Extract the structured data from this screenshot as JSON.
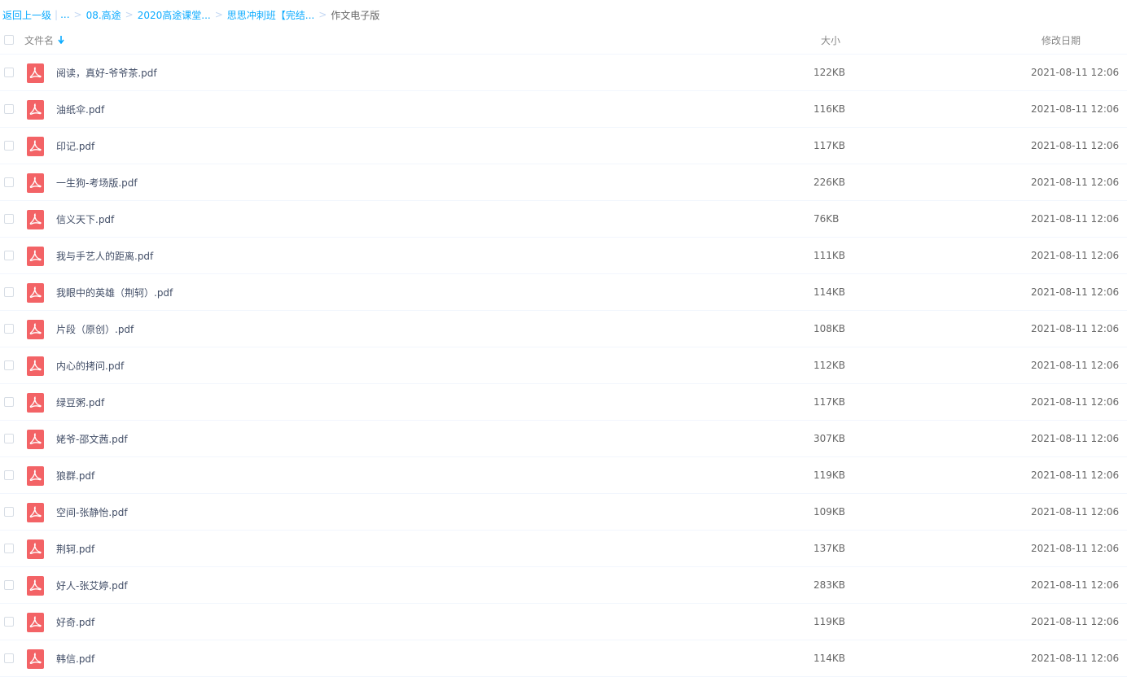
{
  "breadcrumb": {
    "back": "返回上一级",
    "separator": ">",
    "items": [
      "...",
      "08.高途",
      "2020高途课堂...",
      "思思冲刺班【完结...",
      "作文电子版"
    ]
  },
  "columns": {
    "name": "文件名",
    "size": "大小",
    "date": "修改日期",
    "sort_icon": "arrow-down-icon"
  },
  "files": [
    {
      "name": "阅读，真好-爷爷茶.pdf",
      "size": "122KB",
      "date": "2021-08-11 12:06"
    },
    {
      "name": "油纸伞.pdf",
      "size": "116KB",
      "date": "2021-08-11 12:06"
    },
    {
      "name": "印记.pdf",
      "size": "117KB",
      "date": "2021-08-11 12:06"
    },
    {
      "name": "一生狗-考场版.pdf",
      "size": "226KB",
      "date": "2021-08-11 12:06"
    },
    {
      "name": "信义天下.pdf",
      "size": "76KB",
      "date": "2021-08-11 12:06"
    },
    {
      "name": "我与手艺人的距离.pdf",
      "size": "111KB",
      "date": "2021-08-11 12:06"
    },
    {
      "name": "我眼中的英雄（荆轲）.pdf",
      "size": "114KB",
      "date": "2021-08-11 12:06"
    },
    {
      "name": "片段（原创）.pdf",
      "size": "108KB",
      "date": "2021-08-11 12:06"
    },
    {
      "name": "内心的拷问.pdf",
      "size": "112KB",
      "date": "2021-08-11 12:06"
    },
    {
      "name": "绿豆粥.pdf",
      "size": "117KB",
      "date": "2021-08-11 12:06"
    },
    {
      "name": "姥爷-邵文茜.pdf",
      "size": "307KB",
      "date": "2021-08-11 12:06"
    },
    {
      "name": "狼群.pdf",
      "size": "119KB",
      "date": "2021-08-11 12:06"
    },
    {
      "name": "空间-张静怡.pdf",
      "size": "109KB",
      "date": "2021-08-11 12:06"
    },
    {
      "name": "荆轲.pdf",
      "size": "137KB",
      "date": "2021-08-11 12:06"
    },
    {
      "name": "好人-张艾婷.pdf",
      "size": "283KB",
      "date": "2021-08-11 12:06"
    },
    {
      "name": "好奇.pdf",
      "size": "119KB",
      "date": "2021-08-11 12:06"
    },
    {
      "name": "韩信.pdf",
      "size": "114KB",
      "date": "2021-08-11 12:06"
    }
  ],
  "colors": {
    "link": "#09aaff",
    "pdf_icon": "#f36366",
    "text": "#424e67",
    "muted": "#888888"
  }
}
